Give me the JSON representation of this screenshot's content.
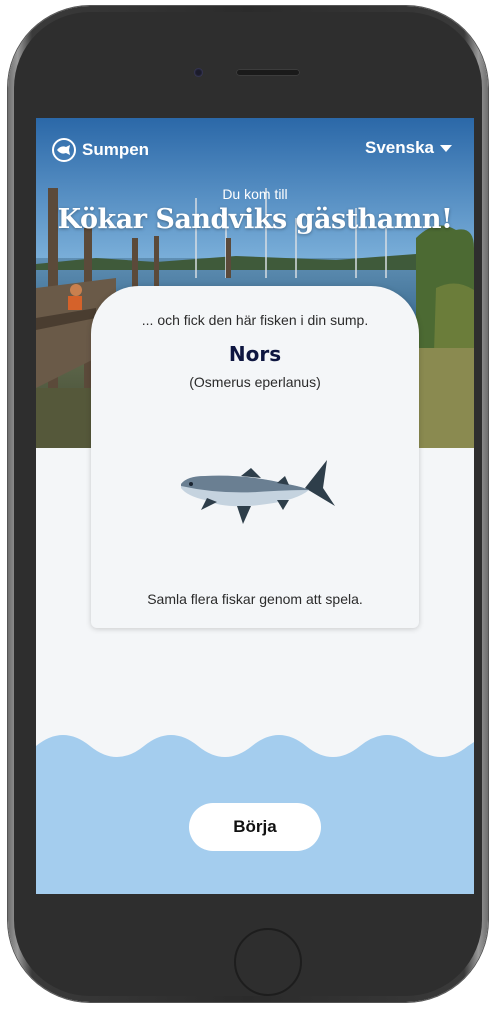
{
  "header": {
    "logo_label": "Sumpen",
    "language_label": "Svenska"
  },
  "hero": {
    "arrival_prefix": "Du kom till",
    "harbor_title": "Kökar Sandviks gästhamn!"
  },
  "card": {
    "intro": "... och fick den här fisken i din sump.",
    "fish_name": "Nors",
    "fish_latin": "(Osmerus eperlanus)",
    "footer_text": "Samla flera fiskar genom att spela."
  },
  "actions": {
    "start_label": "Börja"
  },
  "icons": {
    "logo": "fish-in-circle-icon",
    "language": "caret-down-icon"
  },
  "colors": {
    "water": "#a4cdee",
    "card_bg": "#f4f6f8",
    "fish_name": "#0e1640"
  }
}
